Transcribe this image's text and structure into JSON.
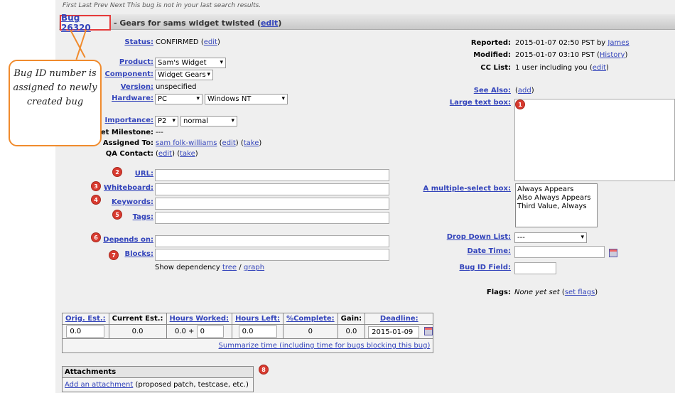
{
  "nav": {
    "text": "First Last Prev Next    This bug is not in your last search results."
  },
  "bug": {
    "id_label": "Bug 26320",
    "summary": "- Gears for sams widget twisted",
    "edit": "edit"
  },
  "callout": {
    "text": "Bug ID number is assigned to newly created bug"
  },
  "left": {
    "status_label": "Status:",
    "status_value": "CONFIRMED",
    "status_edit": "edit",
    "product_label": "Product:",
    "product_value": "Sam's Widget",
    "component_label": "Component:",
    "component_value": "Widget Gears",
    "version_label": "Version:",
    "version_value": "unspecified",
    "hardware_label": "Hardware:",
    "hardware_value": "PC",
    "os_value": "Windows NT",
    "importance_label": "Importance:",
    "priority_value": "P2",
    "severity_value": "normal",
    "milestone_label": "et Milestone:",
    "milestone_value": "---",
    "assigned_label": "Assigned To:",
    "assigned_value": "sam folk-williams",
    "assigned_edit": "edit",
    "assigned_take": "take",
    "qa_label": "QA Contact:",
    "qa_edit": "edit",
    "qa_take": "take",
    "url_label": "URL:",
    "whiteboard_label": "Whiteboard:",
    "keywords_label": "Keywords:",
    "tags_label": "Tags:",
    "depends_label": "Depends on:",
    "blocks_label": "Blocks:",
    "dep_text": "Show dependency",
    "dep_tree": "tree",
    "dep_sep": "/",
    "dep_graph": "graph"
  },
  "right": {
    "reported_label": "Reported:",
    "reported_value": "2015-01-07 02:50 PST by",
    "reported_by": "James",
    "modified_label": "Modified:",
    "modified_value": "2015-01-07 03:10 PST",
    "history": "History",
    "cc_label": "CC List:",
    "cc_value": "1 user including you",
    "cc_edit": "edit",
    "seealso_label": "See Also:",
    "seealso_add": "add",
    "largetext_label": "Large text box:",
    "multisel_label": "A multiple-select box:",
    "multisel_options": [
      "Always Appears",
      "Also Always Appears",
      "Third Value, Always"
    ],
    "dropdown_label": "Drop Down List:",
    "dropdown_value": "---",
    "date_label": "Date Time:",
    "bugidfield_label": "Bug ID Field:",
    "flags_label": "Flags:",
    "flags_value": "None yet set",
    "set_flags": "set flags"
  },
  "badges": [
    "1",
    "2",
    "3",
    "4",
    "5",
    "6",
    "7",
    "8"
  ],
  "time": {
    "headers": [
      "Orig. Est.:",
      "Current Est.:",
      "Hours Worked:",
      "Hours Left:",
      "%Complete:",
      "Gain:",
      "Deadline:"
    ],
    "orig": "0.0",
    "current": "0.0",
    "worked": "0.0",
    "plus": "+",
    "worked_add": "0",
    "left": "0.0",
    "complete": "0",
    "gain": "0.0",
    "deadline": "2015-01-09",
    "summarize": "Summarize time (including time for bugs blocking this bug)"
  },
  "attachments": {
    "title": "Attachments",
    "add": "Add an attachment",
    "hint": "(proposed patch, testcase, etc.)"
  }
}
